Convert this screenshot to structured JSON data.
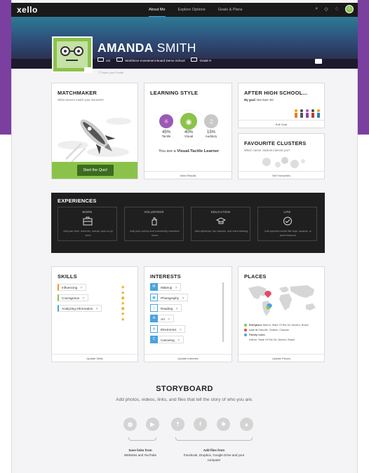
{
  "app": {
    "logo": "xello"
  },
  "nav": {
    "links": [
      {
        "label": "About Me",
        "active": true
      },
      {
        "label": "Explore Options",
        "active": false
      },
      {
        "label": "Goals & Plans",
        "active": false
      }
    ],
    "icons": [
      "search-icon",
      "shield-icon",
      "bell-icon"
    ],
    "avatar_initial": "A"
  },
  "profile": {
    "first_name": "AMANDA",
    "last_name": "SMITH",
    "country": "US",
    "school": "Workforce Investment Board Demo School",
    "grade": "Grade 9",
    "share_label": "Share your Profile"
  },
  "matchmaker": {
    "title": "MATCHMAKER",
    "subtitle": "What careers match your interests?",
    "button": "Start the Quiz!"
  },
  "learning_style": {
    "title": "LEARNING STYLE",
    "styles": [
      {
        "pct": "45%",
        "label": "Tactile",
        "color": "#9b59b6"
      },
      {
        "pct": "40%",
        "label": "Visual",
        "color": "#8bc34a"
      },
      {
        "pct": "15%",
        "label": "Auditory",
        "color": "#c8c8c8"
      }
    ],
    "result_prefix": "You are a ",
    "result_bold": "Visual-Tactile Learner",
    "footer": "View Results"
  },
  "after_high_school": {
    "title": "AFTER HIGH SCHOOL...",
    "goal_label": "My goal:",
    "goal_value": "Not Sure Yet",
    "footer": "Edit Goal"
  },
  "clusters": {
    "title": "FAVOURITE CLUSTERS",
    "subtitle": "Which career clusters interest you?",
    "footer": "Set Favourites"
  },
  "experiences": {
    "title": "EXPERIENCES",
    "items": [
      {
        "label": "WORK",
        "desc": "Add part-time, summer, casual, and co-op work",
        "icon": "briefcase-icon"
      },
      {
        "label": "VOLUNTEER",
        "desc": "Add your school and community volunteer hours",
        "icon": "hand-icon"
      },
      {
        "label": "EDUCATION",
        "desc": "Add diplomas, fun classes, and extra training",
        "icon": "graduation-cap-icon"
      },
      {
        "label": "LIFE",
        "desc": "Add special events like trips, awards, or performances",
        "icon": "checkmark-icon"
      }
    ]
  },
  "skills": {
    "title": "SKILLS",
    "items": [
      {
        "label": "Influencing",
        "color": "#f39c12",
        "stars": "★ ★ ★"
      },
      {
        "label": "Courageous",
        "color": "#8bc34a",
        "stars": "★ ★ ★"
      },
      {
        "label": "Analyzing Information",
        "color": "#4aa3df",
        "stars": "★ ★ ★"
      }
    ],
    "footer": "Update Skills"
  },
  "interests": {
    "title": "INTERESTS",
    "items": [
      {
        "letter": "M",
        "label": "Makeup",
        "outline": false
      },
      {
        "letter": "▣",
        "label": "Photography",
        "outline": true
      },
      {
        "letter": "▯",
        "label": "Reading",
        "outline": true
      },
      {
        "letter": "A",
        "label": "Art",
        "outline": false
      },
      {
        "letter": "⚙",
        "label": "Electronics",
        "outline": true
      },
      {
        "letter": "C",
        "label": "Canoeing",
        "outline": false
      }
    ],
    "footer": "Update Interests"
  },
  "places": {
    "title": "PLACES",
    "entries": [
      {
        "bold": "Birthplace",
        "text": " Niterói, State Of Rio De Janeiro, Brazil",
        "color": "#8bc34a"
      },
      {
        "bold": "Live in",
        "text": " Oakville, Ontario, Canada",
        "color": "#e04a6a"
      },
      {
        "bold": "Family roots",
        "text": "",
        "color": "#4aa3df"
      },
      {
        "bold": "",
        "text": "Niterói, State Of Rio De Janeiro, Brazil",
        "color": ""
      }
    ],
    "footer": "Update Places"
  },
  "storyboard": {
    "title": "STORYBOARD",
    "subtitle": "Add photos, videos, links, and files that tell the story of who you are.",
    "links_caption_1": "Save links from",
    "links_caption_2": "Websites and YouTube",
    "files_caption_1": "Add files from",
    "files_caption_2": "Facebook, Dropbox, Google Drive and your",
    "files_caption_3": "computer",
    "icons": [
      {
        "name": "globe-icon",
        "glyph": "◍"
      },
      {
        "name": "youtube-icon",
        "glyph": "▶"
      },
      {
        "name": "upload-icon",
        "glyph": "⇡"
      },
      {
        "name": "facebook-icon",
        "glyph": "f"
      },
      {
        "name": "dropbox-icon",
        "glyph": "❖"
      },
      {
        "name": "google-drive-icon",
        "glyph": "▲"
      }
    ]
  }
}
